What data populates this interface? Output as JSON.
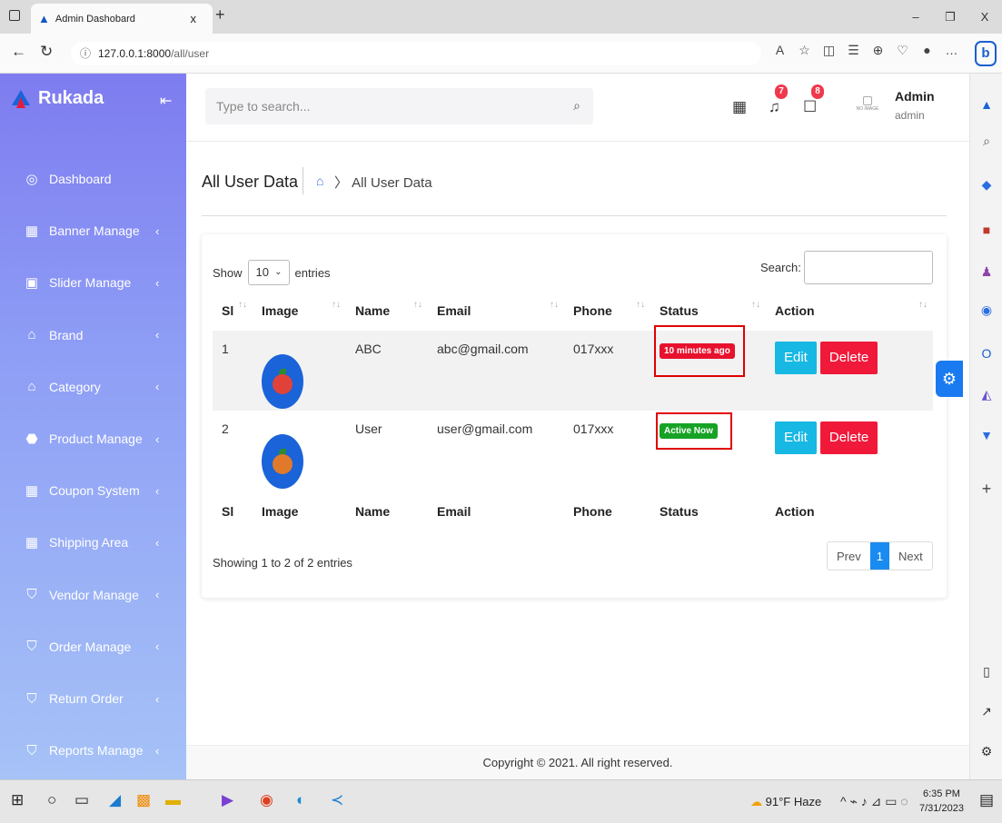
{
  "browser": {
    "tab_title": "Admin Dashobard",
    "tab_close": "x",
    "new_tab": "+",
    "url_host": "127.0.0.1:8000",
    "url_path": "/all/user"
  },
  "sidebar": {
    "brand": "Rukada",
    "items": [
      {
        "label": "Dashboard",
        "icon": "dashboard-icon",
        "glyph": "◎"
      },
      {
        "label": "Banner Manage",
        "icon": "grid-icon",
        "glyph": "▦"
      },
      {
        "label": "Slider Manage",
        "icon": "image-icon",
        "glyph": "▣"
      },
      {
        "label": "Brand",
        "icon": "home-icon",
        "glyph": "⌂"
      },
      {
        "label": "Category",
        "icon": "home-icon",
        "glyph": "⌂"
      },
      {
        "label": "Product Manage",
        "icon": "lock-icon",
        "glyph": "⬣"
      },
      {
        "label": "Coupon System",
        "icon": "grid-icon",
        "glyph": "▦"
      },
      {
        "label": "Shipping Area",
        "icon": "grid-icon",
        "glyph": "▦"
      },
      {
        "label": "Vendor Manage",
        "icon": "cart-icon",
        "glyph": "⛉"
      },
      {
        "label": "Order Manage",
        "icon": "cart-icon",
        "glyph": "⛉"
      },
      {
        "label": "Return Order",
        "icon": "cart-icon",
        "glyph": "⛉"
      },
      {
        "label": "Reports Manage",
        "icon": "cart-icon",
        "glyph": "⛉"
      }
    ]
  },
  "header": {
    "search_placeholder": "Type to search...",
    "notifications_count": "7",
    "messages_count": "8",
    "avatar_text": "NO IMAGE",
    "user_name": "Admin",
    "user_role": "admin"
  },
  "page": {
    "title": "All User Data",
    "breadcrumb": "All User Data"
  },
  "table_controls": {
    "show_label": "Show",
    "page_length": "10",
    "entries_label": "entries",
    "search_label": "Search:"
  },
  "table": {
    "headers": [
      "Sl",
      "Image",
      "Name",
      "Email",
      "Phone",
      "Status",
      "Action"
    ],
    "rows": [
      {
        "sl": "1",
        "name": "ABC",
        "email": "abc@gmail.com",
        "phone": "017xxx",
        "status": "10 minutes ago",
        "status_color": "#e8112d",
        "edit": "Edit",
        "delete": "Delete"
      },
      {
        "sl": "2",
        "name": "User",
        "email": "user@gmail.com",
        "phone": "017xxx",
        "status": "Active Now",
        "status_color": "#16a325",
        "edit": "Edit",
        "delete": "Delete"
      }
    ]
  },
  "pagination": {
    "info": "Showing 1 to 2 of 2 entries",
    "prev": "Prev",
    "current": "1",
    "next": "Next"
  },
  "footer": "Copyright © 2021. All right reserved.",
  "taskbar": {
    "weather": "91°F Haze",
    "time": "6:35 PM",
    "date": "7/31/2023"
  }
}
